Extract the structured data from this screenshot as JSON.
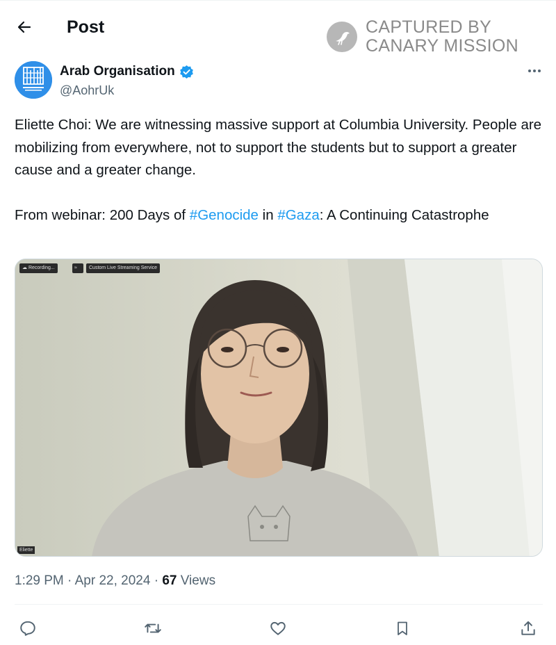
{
  "header": {
    "back_icon": "arrow-left-icon",
    "title": "Post"
  },
  "watermark": {
    "line1": "CAPTURED BY",
    "line2": "CANARY MISSION",
    "color": "#8a8a8a"
  },
  "author": {
    "name": "Arab Organisation",
    "handle": "@AohrUk",
    "verified_icon": "verified-badge-icon",
    "verified_color": "#1d9bf0",
    "avatar_color": "#2f8fe8"
  },
  "post": {
    "text_line1": "Eliette Choi: We are witnessing massive support at Columbia University. People are mobilizing from everywhere, not to support the students but to support a greater cause and a greater change.",
    "text_prefix": "From webinar: 200 Days of ",
    "hashtag1": "#Genocide",
    "text_mid": " in ",
    "hashtag2": "#Gaza",
    "text_suffix": ": A Continuing Catastrophe",
    "hashtag_color": "#1d9bf0"
  },
  "media": {
    "chip_recording": "Recording...",
    "chip_streaming": "Custom Live Streaming Service",
    "name_tag": "Eliette"
  },
  "meta": {
    "time": "1:29 PM",
    "separator": " · ",
    "date": "Apr 22, 2024",
    "views_count": "67",
    "views_label": " Views"
  },
  "actions": [
    {
      "name": "reply",
      "icon": "reply-icon"
    },
    {
      "name": "repost",
      "icon": "repost-icon"
    },
    {
      "name": "like",
      "icon": "heart-icon"
    },
    {
      "name": "bookmark",
      "icon": "bookmark-icon"
    },
    {
      "name": "share",
      "icon": "share-icon"
    }
  ]
}
